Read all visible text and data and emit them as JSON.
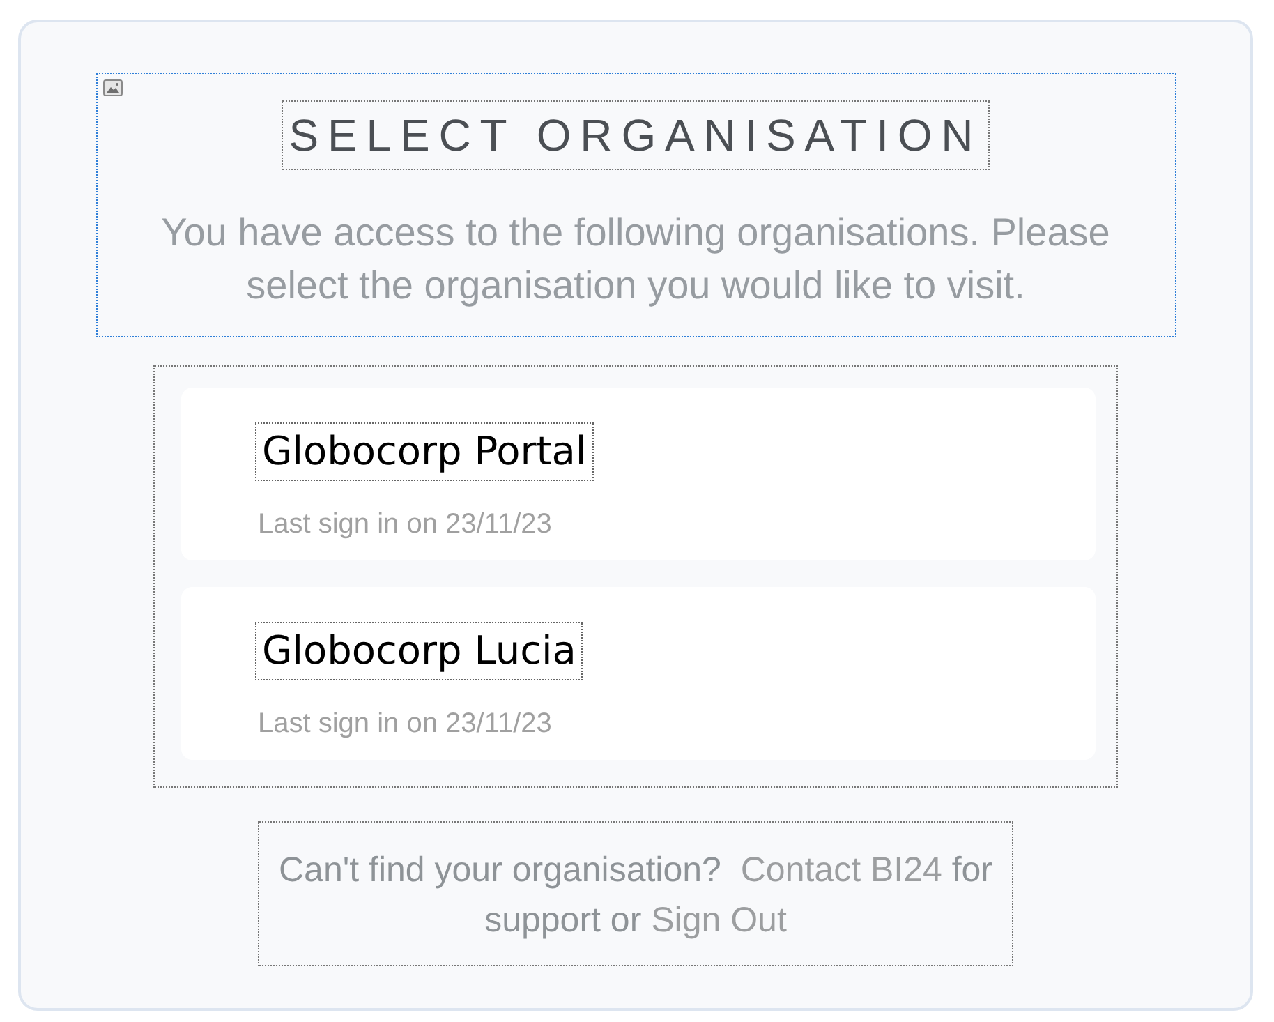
{
  "header": {
    "title": "SELECT ORGANISATION",
    "subtitle": "You have access to the following organisations. Please select the organisation you would like to visit."
  },
  "organisations": [
    {
      "name": "Globocorp Portal",
      "last_sign_in": "Last sign in on 23/11/23"
    },
    {
      "name": "Globocorp Lucia",
      "last_sign_in": "Last sign in on 23/11/23"
    }
  ],
  "footer": {
    "segments": [
      {
        "kind": "text",
        "text": "Can't find your organisation?  "
      },
      {
        "kind": "link",
        "text": "Contact BI24"
      },
      {
        "kind": "text",
        "text": " for support or "
      },
      {
        "kind": "link",
        "text": "Sign Out"
      }
    ]
  }
}
